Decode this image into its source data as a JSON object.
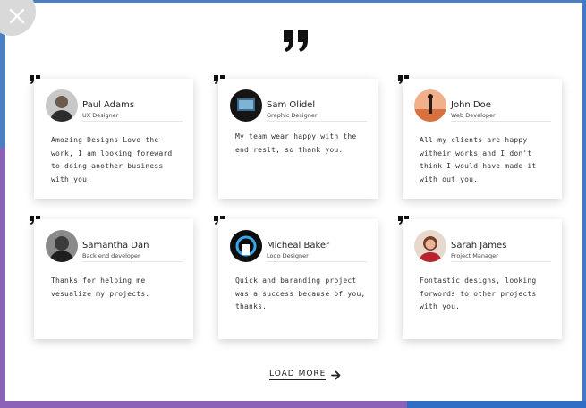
{
  "load_more": {
    "label": "LOAD MORE"
  },
  "testimonials": [
    {
      "name": "Paul Adams",
      "role": "UX Designer",
      "text": "Amozing Designs Love the work, I am looking foreward to doing another business with you."
    },
    {
      "name": "Sam Olidel",
      "role": "Graphic Designer",
      "text": "My team wear happy with the end reslt, so thank you."
    },
    {
      "name": "John Doe",
      "role": "Web Developer",
      "text": "All my clients are happy witheir works and I don't think I would have made it with out you."
    },
    {
      "name": "Samantha Dan",
      "role": "Back end developer",
      "text": "Thanks for helping me vesualize my projects."
    },
    {
      "name": "Micheal Baker",
      "role": "Logo Designer",
      "text": "Quick and baranding project was a success because of you, thanks."
    },
    {
      "name": "Sarah James",
      "role": "Project Manager",
      "text": "Fontastic designs, looking forwords to other projects with you."
    }
  ],
  "colors": {
    "frame_blue": "#4a7fc6",
    "frame_purple": "#8a63b8",
    "text_dark": "#222222"
  }
}
